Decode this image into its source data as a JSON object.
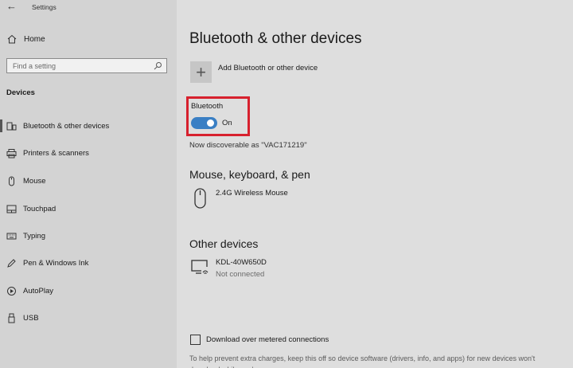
{
  "window": {
    "title": "Settings"
  },
  "sidebar": {
    "home_label": "Home",
    "search_placeholder": "Find a setting",
    "section_label": "Devices",
    "items": [
      {
        "label": "Bluetooth & other devices",
        "icon": "bluetooth-devices-icon",
        "active": true
      },
      {
        "label": "Printers & scanners",
        "icon": "printer-icon"
      },
      {
        "label": "Mouse",
        "icon": "mouse-icon"
      },
      {
        "label": "Touchpad",
        "icon": "touchpad-icon"
      },
      {
        "label": "Typing",
        "icon": "keyboard-icon"
      },
      {
        "label": "Pen & Windows Ink",
        "icon": "pen-icon"
      },
      {
        "label": "AutoPlay",
        "icon": "autoplay-icon"
      },
      {
        "label": "USB",
        "icon": "usb-icon"
      }
    ]
  },
  "main": {
    "title": "Bluetooth & other devices",
    "add_device_label": "Add Bluetooth or other device",
    "bluetooth": {
      "label": "Bluetooth",
      "toggle_state": "On",
      "discoverable_text": "Now discoverable as \"VAC171219\""
    },
    "mouse_section": {
      "heading": "Mouse, keyboard, & pen",
      "devices": [
        {
          "name": "2.4G Wireless Mouse",
          "icon": "mouse-icon"
        }
      ]
    },
    "other_section": {
      "heading": "Other devices",
      "devices": [
        {
          "name": "KDL-40W650D",
          "status": "Not connected",
          "icon": "wireless-display-icon"
        }
      ]
    },
    "metered": {
      "label": "Download over metered connections",
      "help": "To help prevent extra charges, keep this off so device software (drivers, info, and apps) for new devices won't download while you're on"
    }
  },
  "colors": {
    "accent": "#3a7fc4",
    "highlight": "#d7212e"
  }
}
